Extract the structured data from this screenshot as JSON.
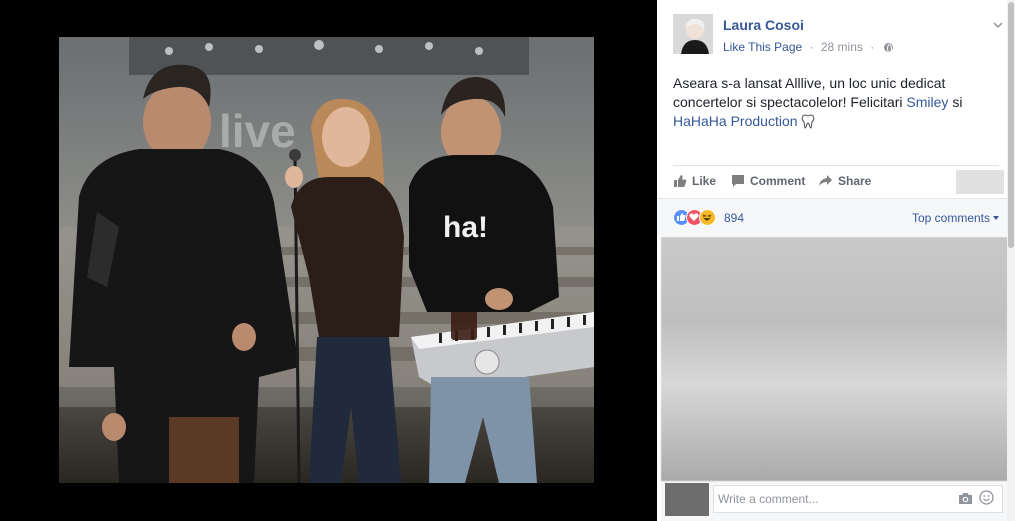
{
  "post": {
    "author": "Laura Cosoi",
    "like_page": "Like This Page",
    "separator": "·",
    "time": "28 mins",
    "text": {
      "part1": "Aseara s-a lansat Alllive, un loc unic dedicat concertelor si spectacolelor! Felicitari",
      "link1": "Smiley",
      "part2": "si",
      "link2": "HaHaHa Production"
    }
  },
  "actions": {
    "like": "Like",
    "comment": "Comment",
    "share": "Share"
  },
  "reactions": {
    "count": "894",
    "types": [
      "like",
      "love",
      "haha"
    ],
    "sort_label": "Top comments"
  },
  "composer": {
    "placeholder": "Write a comment..."
  },
  "photo": {
    "tshirt_text": "ha!",
    "banner_text": "live"
  },
  "colors": {
    "link": "#365899",
    "like_reaction": "#5890ff",
    "love_reaction": "#f25268",
    "haha_reaction": "#f7b928"
  }
}
